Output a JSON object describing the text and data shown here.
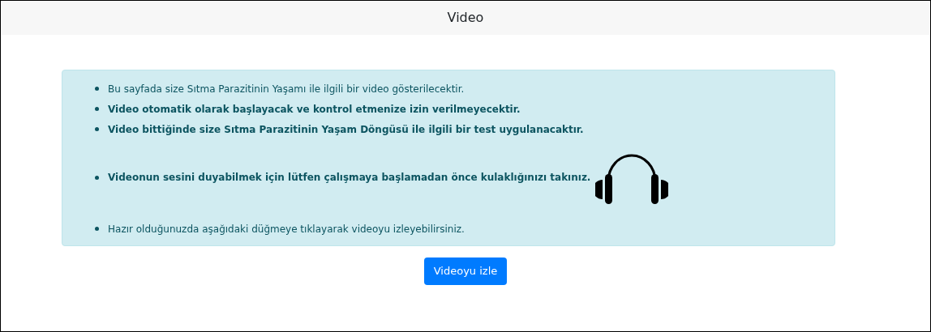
{
  "header": {
    "title": "Video"
  },
  "notice": {
    "items": [
      {
        "kind": "text",
        "bold": false,
        "text": "Bu sayfada size Sıtma Parazitinin Yaşamı ile ilgili bir video gösterilecektir."
      },
      {
        "kind": "text",
        "bold": true,
        "text": "Video otomatik olarak başlayacak ve kontrol etmenize izin verilmeyecektir."
      },
      {
        "kind": "text",
        "bold": true,
        "text": "Video bittiğinde size Sıtma Parazitinin Yaşam Döngüsü ile ilgili bir test uygulanacaktır."
      },
      {
        "kind": "headphones",
        "bold": true,
        "text": "Videonun sesini duyabilmek için lütfen çalışmaya başlamadan önce kulaklığınızı takınız."
      },
      {
        "kind": "text",
        "bold": false,
        "text": "Hazır olduğunuzda aşağıdaki düğmeye tıklayarak videoyu izleyebilirsiniz."
      }
    ]
  },
  "button": {
    "label": "Videoyu izle"
  }
}
